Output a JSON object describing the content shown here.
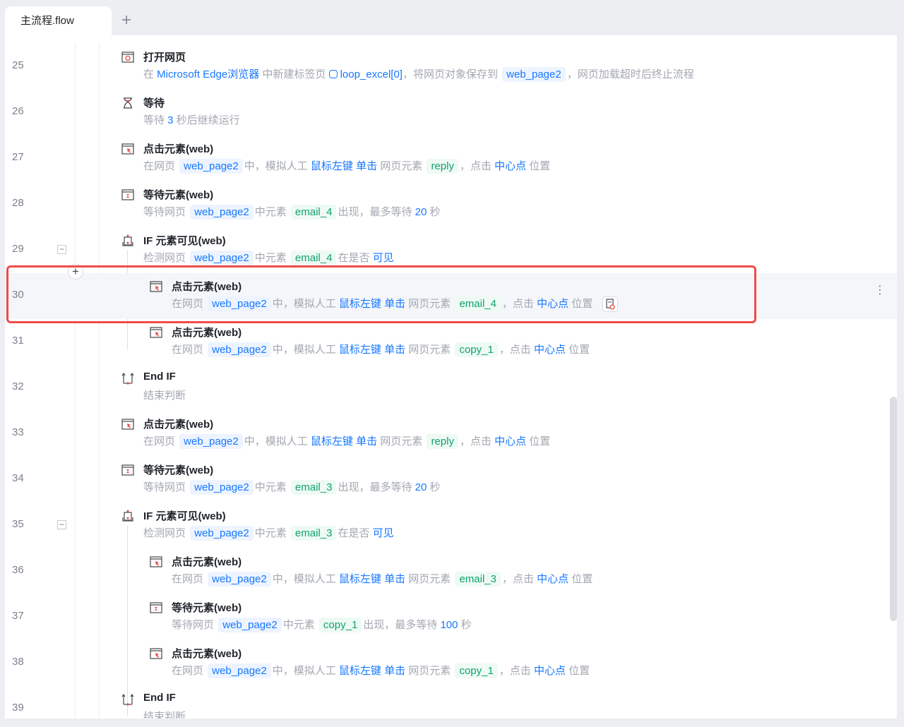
{
  "tab": {
    "label": "主流程.flow",
    "add_label": "+"
  },
  "colors": {
    "link": "#1677ff",
    "element": "#11a26d",
    "highlight": "#ef4b4b"
  },
  "rows": [
    {
      "no": "25",
      "indent": 0,
      "icon": "open-webpage-icon",
      "title": "打开网页",
      "desc": [
        {
          "t": "在 ",
          "k": "p"
        },
        {
          "t": "Microsoft Edge浏览器",
          "k": "l"
        },
        {
          "t": " 中新建标签页 ",
          "k": "p"
        },
        {
          "t": "loop_excel[0]",
          "k": "py"
        },
        {
          "t": "，将网页对象保存到 ",
          "k": "p"
        },
        {
          "t": "web_page2",
          "k": "v"
        },
        {
          "t": "，网页加载超时后终止流程",
          "k": "p"
        }
      ]
    },
    {
      "no": "26",
      "indent": 0,
      "icon": "hourglass-icon",
      "title": "等待",
      "desc": [
        {
          "t": "等待 ",
          "k": "p"
        },
        {
          "t": "3",
          "k": "l"
        },
        {
          "t": " 秒后继续运行",
          "k": "p"
        }
      ]
    },
    {
      "no": "27",
      "indent": 0,
      "icon": "click-element-icon",
      "title": "点击元素(web)",
      "desc": [
        {
          "t": "在网页 ",
          "k": "p"
        },
        {
          "t": "web_page2",
          "k": "v"
        },
        {
          "t": "中，模拟人工 ",
          "k": "p"
        },
        {
          "t": "鼠标左键 单击",
          "k": "l"
        },
        {
          "t": " 网页元素 ",
          "k": "p"
        },
        {
          "t": "reply",
          "k": "e"
        },
        {
          "t": "，点击 ",
          "k": "p"
        },
        {
          "t": "中心点",
          "k": "l"
        },
        {
          "t": " 位置",
          "k": "p"
        }
      ]
    },
    {
      "no": "28",
      "indent": 0,
      "icon": "wait-element-icon",
      "title": "等待元素(web)",
      "desc": [
        {
          "t": "等待网页 ",
          "k": "p"
        },
        {
          "t": "web_page2",
          "k": "v"
        },
        {
          "t": "中元素 ",
          "k": "p"
        },
        {
          "t": "email_4",
          "k": "e"
        },
        {
          "t": "出现，最多等待 ",
          "k": "p"
        },
        {
          "t": "20",
          "k": "l"
        },
        {
          "t": " 秒",
          "k": "p"
        }
      ]
    },
    {
      "no": "29",
      "indent": 0,
      "fold": true,
      "icon": "if-visible-icon",
      "title": "IF 元素可见(web)",
      "desc": [
        {
          "t": "检测网页 ",
          "k": "p"
        },
        {
          "t": "web_page2",
          "k": "v"
        },
        {
          "t": "中元素 ",
          "k": "p"
        },
        {
          "t": "email_4",
          "k": "e"
        },
        {
          "t": "在是否 ",
          "k": "p"
        },
        {
          "t": "可见",
          "k": "l"
        }
      ]
    },
    {
      "no": "30",
      "indent": 1,
      "selected": true,
      "icon": "click-element-icon",
      "title": "点击元素(web)",
      "desc": [
        {
          "t": "在网页 ",
          "k": "p"
        },
        {
          "t": "web_page2",
          "k": "v"
        },
        {
          "t": "中，模拟人工 ",
          "k": "p"
        },
        {
          "t": "鼠标左键 单击",
          "k": "l"
        },
        {
          "t": " 网页元素 ",
          "k": "p"
        },
        {
          "t": "email_4",
          "k": "e"
        },
        {
          "t": "，点击 ",
          "k": "p"
        },
        {
          "t": "中心点",
          "k": "l"
        },
        {
          "t": " 位置",
          "k": "p"
        }
      ]
    },
    {
      "no": "31",
      "indent": 1,
      "icon": "click-element-icon",
      "title": "点击元素(web)",
      "desc": [
        {
          "t": "在网页 ",
          "k": "p"
        },
        {
          "t": "web_page2",
          "k": "v"
        },
        {
          "t": "中，模拟人工 ",
          "k": "p"
        },
        {
          "t": "鼠标左键 单击",
          "k": "l"
        },
        {
          "t": " 网页元素 ",
          "k": "p"
        },
        {
          "t": "copy_1",
          "k": "e"
        },
        {
          "t": "，点击 ",
          "k": "p"
        },
        {
          "t": "中心点",
          "k": "l"
        },
        {
          "t": " 位置",
          "k": "p"
        }
      ]
    },
    {
      "no": "32",
      "indent": 0,
      "icon": "end-if-icon",
      "title": "End IF",
      "desc": [
        {
          "t": "结束判断",
          "k": "p"
        }
      ]
    },
    {
      "no": "33",
      "indent": 0,
      "icon": "click-element-icon",
      "title": "点击元素(web)",
      "desc": [
        {
          "t": "在网页 ",
          "k": "p"
        },
        {
          "t": "web_page2",
          "k": "v"
        },
        {
          "t": "中，模拟人工 ",
          "k": "p"
        },
        {
          "t": "鼠标左键 单击",
          "k": "l"
        },
        {
          "t": " 网页元素 ",
          "k": "p"
        },
        {
          "t": "reply",
          "k": "e"
        },
        {
          "t": "，点击 ",
          "k": "p"
        },
        {
          "t": "中心点",
          "k": "l"
        },
        {
          "t": " 位置",
          "k": "p"
        }
      ]
    },
    {
      "no": "34",
      "indent": 0,
      "icon": "wait-element-icon",
      "title": "等待元素(web)",
      "desc": [
        {
          "t": "等待网页 ",
          "k": "p"
        },
        {
          "t": "web_page2",
          "k": "v"
        },
        {
          "t": "中元素 ",
          "k": "p"
        },
        {
          "t": "email_3",
          "k": "e"
        },
        {
          "t": "出现，最多等待 ",
          "k": "p"
        },
        {
          "t": "20",
          "k": "l"
        },
        {
          "t": " 秒",
          "k": "p"
        }
      ]
    },
    {
      "no": "35",
      "indent": 0,
      "fold": true,
      "icon": "if-visible-icon",
      "title": "IF 元素可见(web)",
      "desc": [
        {
          "t": "检测网页 ",
          "k": "p"
        },
        {
          "t": "web_page2",
          "k": "v"
        },
        {
          "t": "中元素 ",
          "k": "p"
        },
        {
          "t": "email_3",
          "k": "e"
        },
        {
          "t": "在是否 ",
          "k": "p"
        },
        {
          "t": "可见",
          "k": "l"
        }
      ]
    },
    {
      "no": "36",
      "indent": 1,
      "icon": "click-element-icon",
      "title": "点击元素(web)",
      "desc": [
        {
          "t": "在网页 ",
          "k": "p"
        },
        {
          "t": "web_page2",
          "k": "v"
        },
        {
          "t": "中，模拟人工 ",
          "k": "p"
        },
        {
          "t": "鼠标左键 单击",
          "k": "l"
        },
        {
          "t": " 网页元素 ",
          "k": "p"
        },
        {
          "t": "email_3",
          "k": "e"
        },
        {
          "t": "，点击 ",
          "k": "p"
        },
        {
          "t": "中心点",
          "k": "l"
        },
        {
          "t": " 位置",
          "k": "p"
        }
      ]
    },
    {
      "no": "37",
      "indent": 1,
      "icon": "wait-element-icon",
      "title": "等待元素(web)",
      "desc": [
        {
          "t": "等待网页 ",
          "k": "p"
        },
        {
          "t": "web_page2",
          "k": "v"
        },
        {
          "t": "中元素 ",
          "k": "p"
        },
        {
          "t": "copy_1",
          "k": "e"
        },
        {
          "t": "出现，最多等待 ",
          "k": "p"
        },
        {
          "t": "100",
          "k": "l"
        },
        {
          "t": " 秒",
          "k": "p"
        }
      ]
    },
    {
      "no": "38",
      "indent": 1,
      "icon": "click-element-icon",
      "title": "点击元素(web)",
      "desc": [
        {
          "t": "在网页 ",
          "k": "p"
        },
        {
          "t": "web_page2",
          "k": "v"
        },
        {
          "t": "中，模拟人工 ",
          "k": "p"
        },
        {
          "t": "鼠标左键 单击",
          "k": "l"
        },
        {
          "t": " 网页元素 ",
          "k": "p"
        },
        {
          "t": "copy_1",
          "k": "e"
        },
        {
          "t": "，点击 ",
          "k": "p"
        },
        {
          "t": "中心点",
          "k": "l"
        },
        {
          "t": " 位置",
          "k": "p"
        }
      ]
    },
    {
      "no": "39",
      "indent": 0,
      "icon": "end-if-icon",
      "title": "End IF",
      "desc": [
        {
          "t": "结束判断",
          "k": "p"
        }
      ]
    }
  ],
  "add_step_label": "+",
  "fold_label": "−",
  "more_label": "⋮"
}
